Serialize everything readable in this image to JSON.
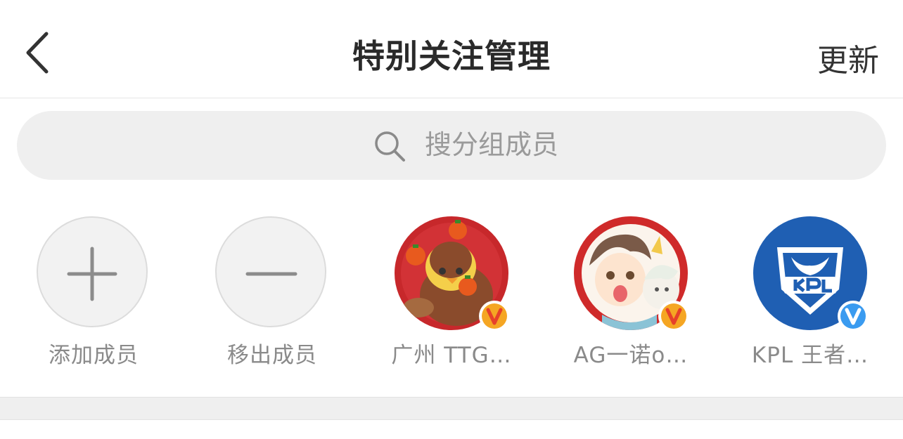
{
  "nav": {
    "back_icon": "chevron-left-icon",
    "title": "特别关注管理",
    "action_label": "更新"
  },
  "search": {
    "placeholder": "搜分组成员",
    "value": "",
    "icon": "search-icon"
  },
  "actions": [
    {
      "label": "添加成员",
      "icon": "plus-icon"
    },
    {
      "label": "移出成员",
      "icon": "minus-icon"
    }
  ],
  "members": [
    {
      "label": "广州 TTG…",
      "badge": "v",
      "badge_color": "#f5a623"
    },
    {
      "label": "AG一诺o…",
      "badge": "v",
      "badge_color": "#f5a623"
    },
    {
      "label": "KPL 王者…",
      "badge": "v",
      "badge_color": "#3a9bf0"
    }
  ],
  "colors": {
    "accent_orange": "#f5a623",
    "accent_blue": "#3a9bf0",
    "avatar_red": "#c7282b",
    "kpl_blue": "#1f5fb3",
    "badge_text_orange": "#e6402a"
  }
}
